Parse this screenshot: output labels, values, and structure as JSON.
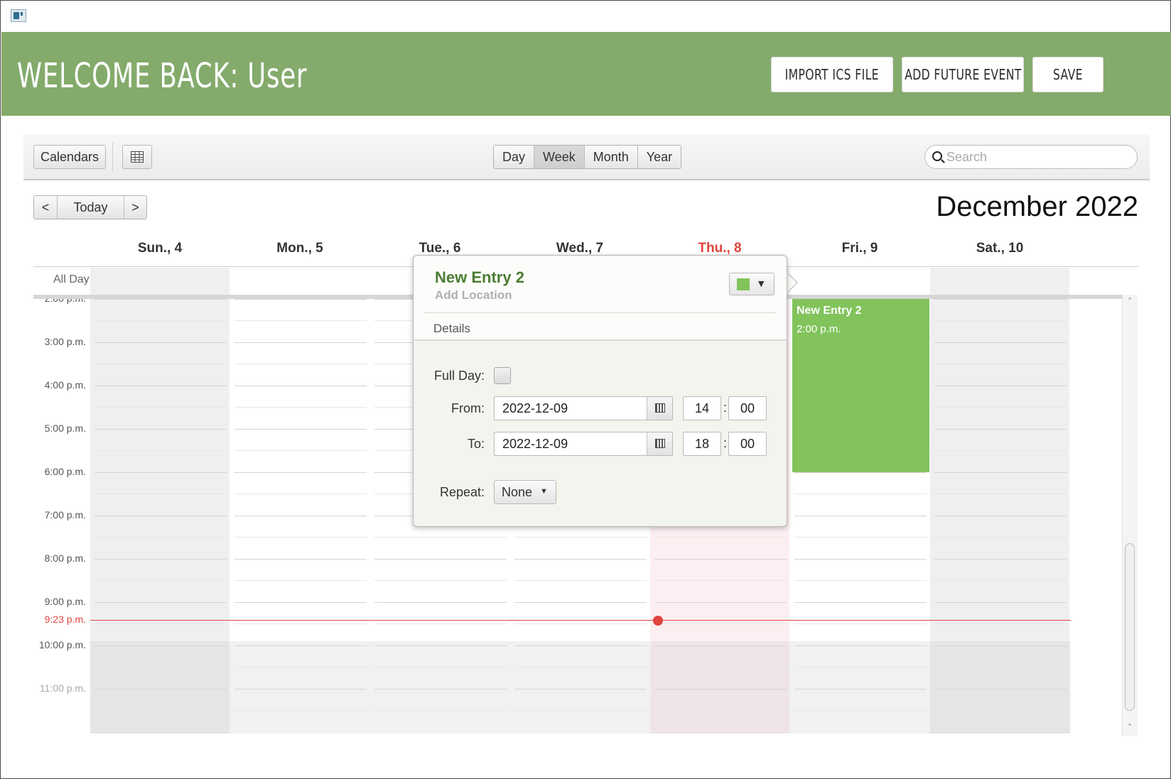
{
  "header": {
    "welcome": "WELCOME BACK: User",
    "import_label": "IMPORT ICS FILE",
    "add_future_label": "ADD FUTURE EVENT",
    "save_label": "SAVE",
    "bg_color": "#84ab6b"
  },
  "toolbar": {
    "calendars_label": "Calendars",
    "grid_icon": "table-grid-icon",
    "views": [
      "Day",
      "Week",
      "Month",
      "Year"
    ],
    "active_view": "Week",
    "search_placeholder": "Search"
  },
  "nav": {
    "prev_label": "<",
    "today_label": "Today",
    "next_label": ">",
    "month_title": "December 2022"
  },
  "days": [
    {
      "label": "Sun., 4",
      "today": false
    },
    {
      "label": "Mon., 5",
      "today": false
    },
    {
      "label": "Tue., 6",
      "today": false
    },
    {
      "label": "Wed., 7",
      "today": false
    },
    {
      "label": "Thu., 8",
      "today": true
    },
    {
      "label": "Fri., 9",
      "today": false
    },
    {
      "label": "Sat., 10",
      "today": false
    }
  ],
  "all_day_label": "All Day",
  "time_labels": [
    "2:00 p.m.",
    "3:00 p.m.",
    "4:00 p.m.",
    "5:00 p.m.",
    "6:00 p.m.",
    "7:00 p.m.",
    "8:00 p.m.",
    "9:00 p.m.",
    "10:00 p.m.",
    "11:00 p.m."
  ],
  "now_label": "9:23 p.m.",
  "event": {
    "title": "New Entry 2",
    "start_label": "2:00 p.m.",
    "color": "#82c35c"
  },
  "popover": {
    "title": "New Entry 2",
    "location_placeholder": "Add Location",
    "details_label": "Details",
    "full_day_label": "Full Day:",
    "from_label": "From:",
    "to_label": "To:",
    "from_date": "2022-12-09",
    "from_hour": "14",
    "from_min": "00",
    "to_date": "2022-12-09",
    "to_hour": "18",
    "to_min": "00",
    "repeat_label": "Repeat:",
    "repeat_value": "None",
    "colon": ":"
  },
  "colors": {
    "today_red": "#e0443e",
    "title_green": "#4b7d33"
  }
}
